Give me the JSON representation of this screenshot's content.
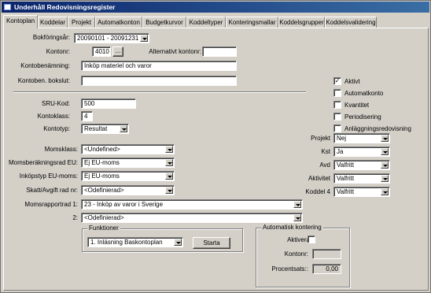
{
  "window": {
    "title": "Underhåll Redovisningsregister"
  },
  "tabs": [
    "Kontoplan",
    "Koddelar",
    "Projekt",
    "Automatkonton",
    "Budgetkurvor",
    "Koddeltyper",
    "Konteringsmallar",
    "Koddelsgrupper",
    "Koddelsvalidering"
  ],
  "form": {
    "fiscal_year_label": "Bokföringsår:",
    "fiscal_year_value": "20090101 - 20091231",
    "account_label": "Kontonr:",
    "account_value": "4010",
    "lookup_label": "...",
    "alt_account_label": "Alternativt kontonr:",
    "alt_account_value": "",
    "account_name_label": "Kontobenämning:",
    "account_name_value": "Inköp materiel och varor",
    "closing_name_label": "Kontoben. bokslut:",
    "closing_name_value": "",
    "sru_label": "SRU-Kod:",
    "sru_value": "500",
    "class_label": "Kontoklass:",
    "class_value": "4",
    "type_label": "Kontotyp:",
    "type_value": "Resultat",
    "vat_class_label": "Momsklass:",
    "vat_class_value": "<Undefined>",
    "vat_eu_label": "Momsberäkningsrad EU:",
    "vat_eu_value": "Ej EU-moms",
    "purchase_vat_label": "Inköpstyp EU-moms:",
    "purchase_vat_value": "Ej EU-moms",
    "tax_label": "Skatt/Avgift rad nr:",
    "tax_value": "<Odefinierad>",
    "vat_report_label": "Momsrapportrad 1:",
    "vat_report_value": "23 - Inköp av varor i Sverige",
    "vat_report2_label": "2:",
    "vat_report2_value": "<Odefinierad>"
  },
  "checkboxes": [
    {
      "label": "Aktivt",
      "checked": true,
      "mark": "✓"
    },
    {
      "label": "Automatkonto",
      "checked": false,
      "mark": ""
    },
    {
      "label": "Kvantitet",
      "checked": false,
      "mark": ""
    },
    {
      "label": "Periodisering",
      "checked": false,
      "mark": ""
    },
    {
      "label": "Anläggningsredovisning",
      "checked": false,
      "mark": ""
    }
  ],
  "dims": {
    "projekt_label": "Projekt",
    "projekt_value": "Nej",
    "kst_label": "Kst",
    "kst_value": "Ja",
    "avd_label": "Avd",
    "avd_value": "Valfritt",
    "aktivitet_label": "Aktivitet",
    "aktivitet_value": "Valfritt",
    "koddel4_label": "Koddel 4",
    "koddel4_value": "Valfritt"
  },
  "functions": {
    "title": "Funktioner",
    "selected": "1. Inläsning Baskontoplan",
    "start_label": "Starta"
  },
  "auto": {
    "title": "Automatisk kontering",
    "activate_label": "Aktivera",
    "account_label": "Kontonr:",
    "account_value": "",
    "percent_label": "Procentsats::",
    "percent_value": "0,00"
  }
}
